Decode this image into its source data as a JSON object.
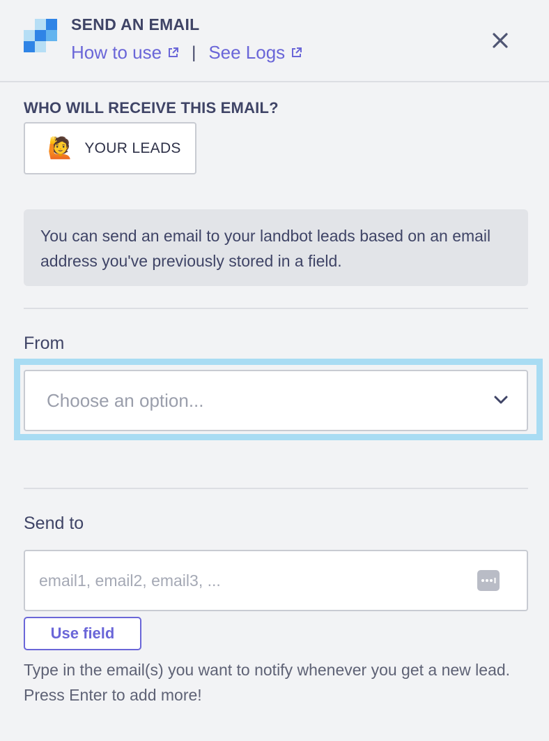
{
  "header": {
    "title": "SEND AN EMAIL",
    "how_to_use": "How to use",
    "separator": "|",
    "see_logs": "See Logs",
    "logo_colors": [
      "#2f84e6",
      "#64b4ef",
      "#b6def5"
    ]
  },
  "recipients": {
    "heading": "WHO WILL RECEIVE THIS EMAIL?",
    "option_label": "YOUR LEADS",
    "option_emoji": "🙋"
  },
  "info": {
    "text": "You can send an email to your landbot leads based on an email address you've previously stored in a field."
  },
  "from": {
    "label": "From",
    "placeholder": "Choose an option...",
    "icon": "chevron-down-icon"
  },
  "send_to": {
    "label": "Send to",
    "placeholder": "email1, email2, email3, ...",
    "value": "",
    "use_field_label": "Use field",
    "helper": "Type in the email(s) you want to notify whenever you get a new lead. Press Enter to add more!"
  },
  "colors": {
    "accent": "#6a66d8",
    "focus_ring": "#a9dcf3",
    "background": "#f2f3f5"
  }
}
